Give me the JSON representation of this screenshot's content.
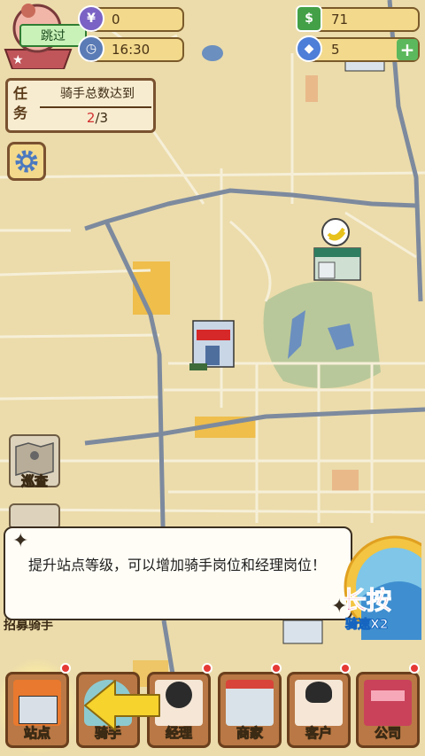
{
  "top_left": {
    "skip_label": "跳过"
  },
  "stats": {
    "coins": "0",
    "time": "16:30",
    "cash": "71",
    "diamonds": "5",
    "plus": "+"
  },
  "task": {
    "side_label_1": "任",
    "side_label_2": "务",
    "title": "骑手总数达到",
    "progress_current": "2",
    "progress_sep": "/",
    "progress_total": "3"
  },
  "side_buttons": {
    "patrol_label": "巡查",
    "recruit_label": "招募骑手"
  },
  "dialog": {
    "message": "提升站点等级，可以增加骑手岗位和经理岗位！"
  },
  "press_button": {
    "label": "长按",
    "sub": "骑速X2"
  },
  "nav": [
    {
      "label": "站点"
    },
    {
      "label": "骑手"
    },
    {
      "label": "经理"
    },
    {
      "label": "商家"
    },
    {
      "label": "客户"
    },
    {
      "label": "公司"
    }
  ],
  "colors": {
    "accent": "#f6d32d",
    "dot": "#e53935",
    "nav": "#b97845"
  }
}
